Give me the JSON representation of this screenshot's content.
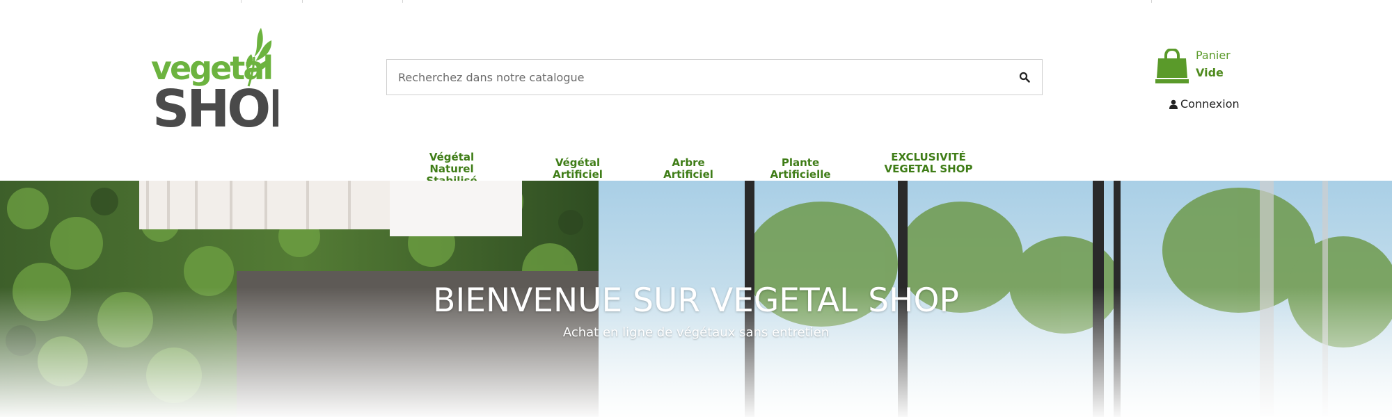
{
  "header": {
    "logo": {
      "text_top": "vegetal",
      "text_bottom": "SHOP"
    },
    "search": {
      "placeholder": "Recherchez dans notre catalogue",
      "icon": "search-icon"
    },
    "cart": {
      "label": "Panier",
      "status": "Vide",
      "icon": "shopping-bag-icon"
    },
    "account": {
      "label": "Connexion",
      "icon": "user-icon"
    }
  },
  "nav": {
    "items": [
      {
        "label": "Végétal Naturel Stabilisé"
      },
      {
        "label": "Végétal Artificiel"
      },
      {
        "label": "Arbre Artificiel"
      },
      {
        "label": "Plante Artificielle"
      },
      {
        "label": "EXCLUSIVITÉ VEGETAL SHOP"
      }
    ]
  },
  "hero": {
    "title": "BIENVENUE SUR VEGETAL SHOP",
    "subtitle": "Achat en ligne de végétaux sans entretien"
  },
  "colors": {
    "brand_green": "#6cb33f",
    "nav_green": "#3f7d17",
    "logo_dark": "#4a4a4a"
  }
}
